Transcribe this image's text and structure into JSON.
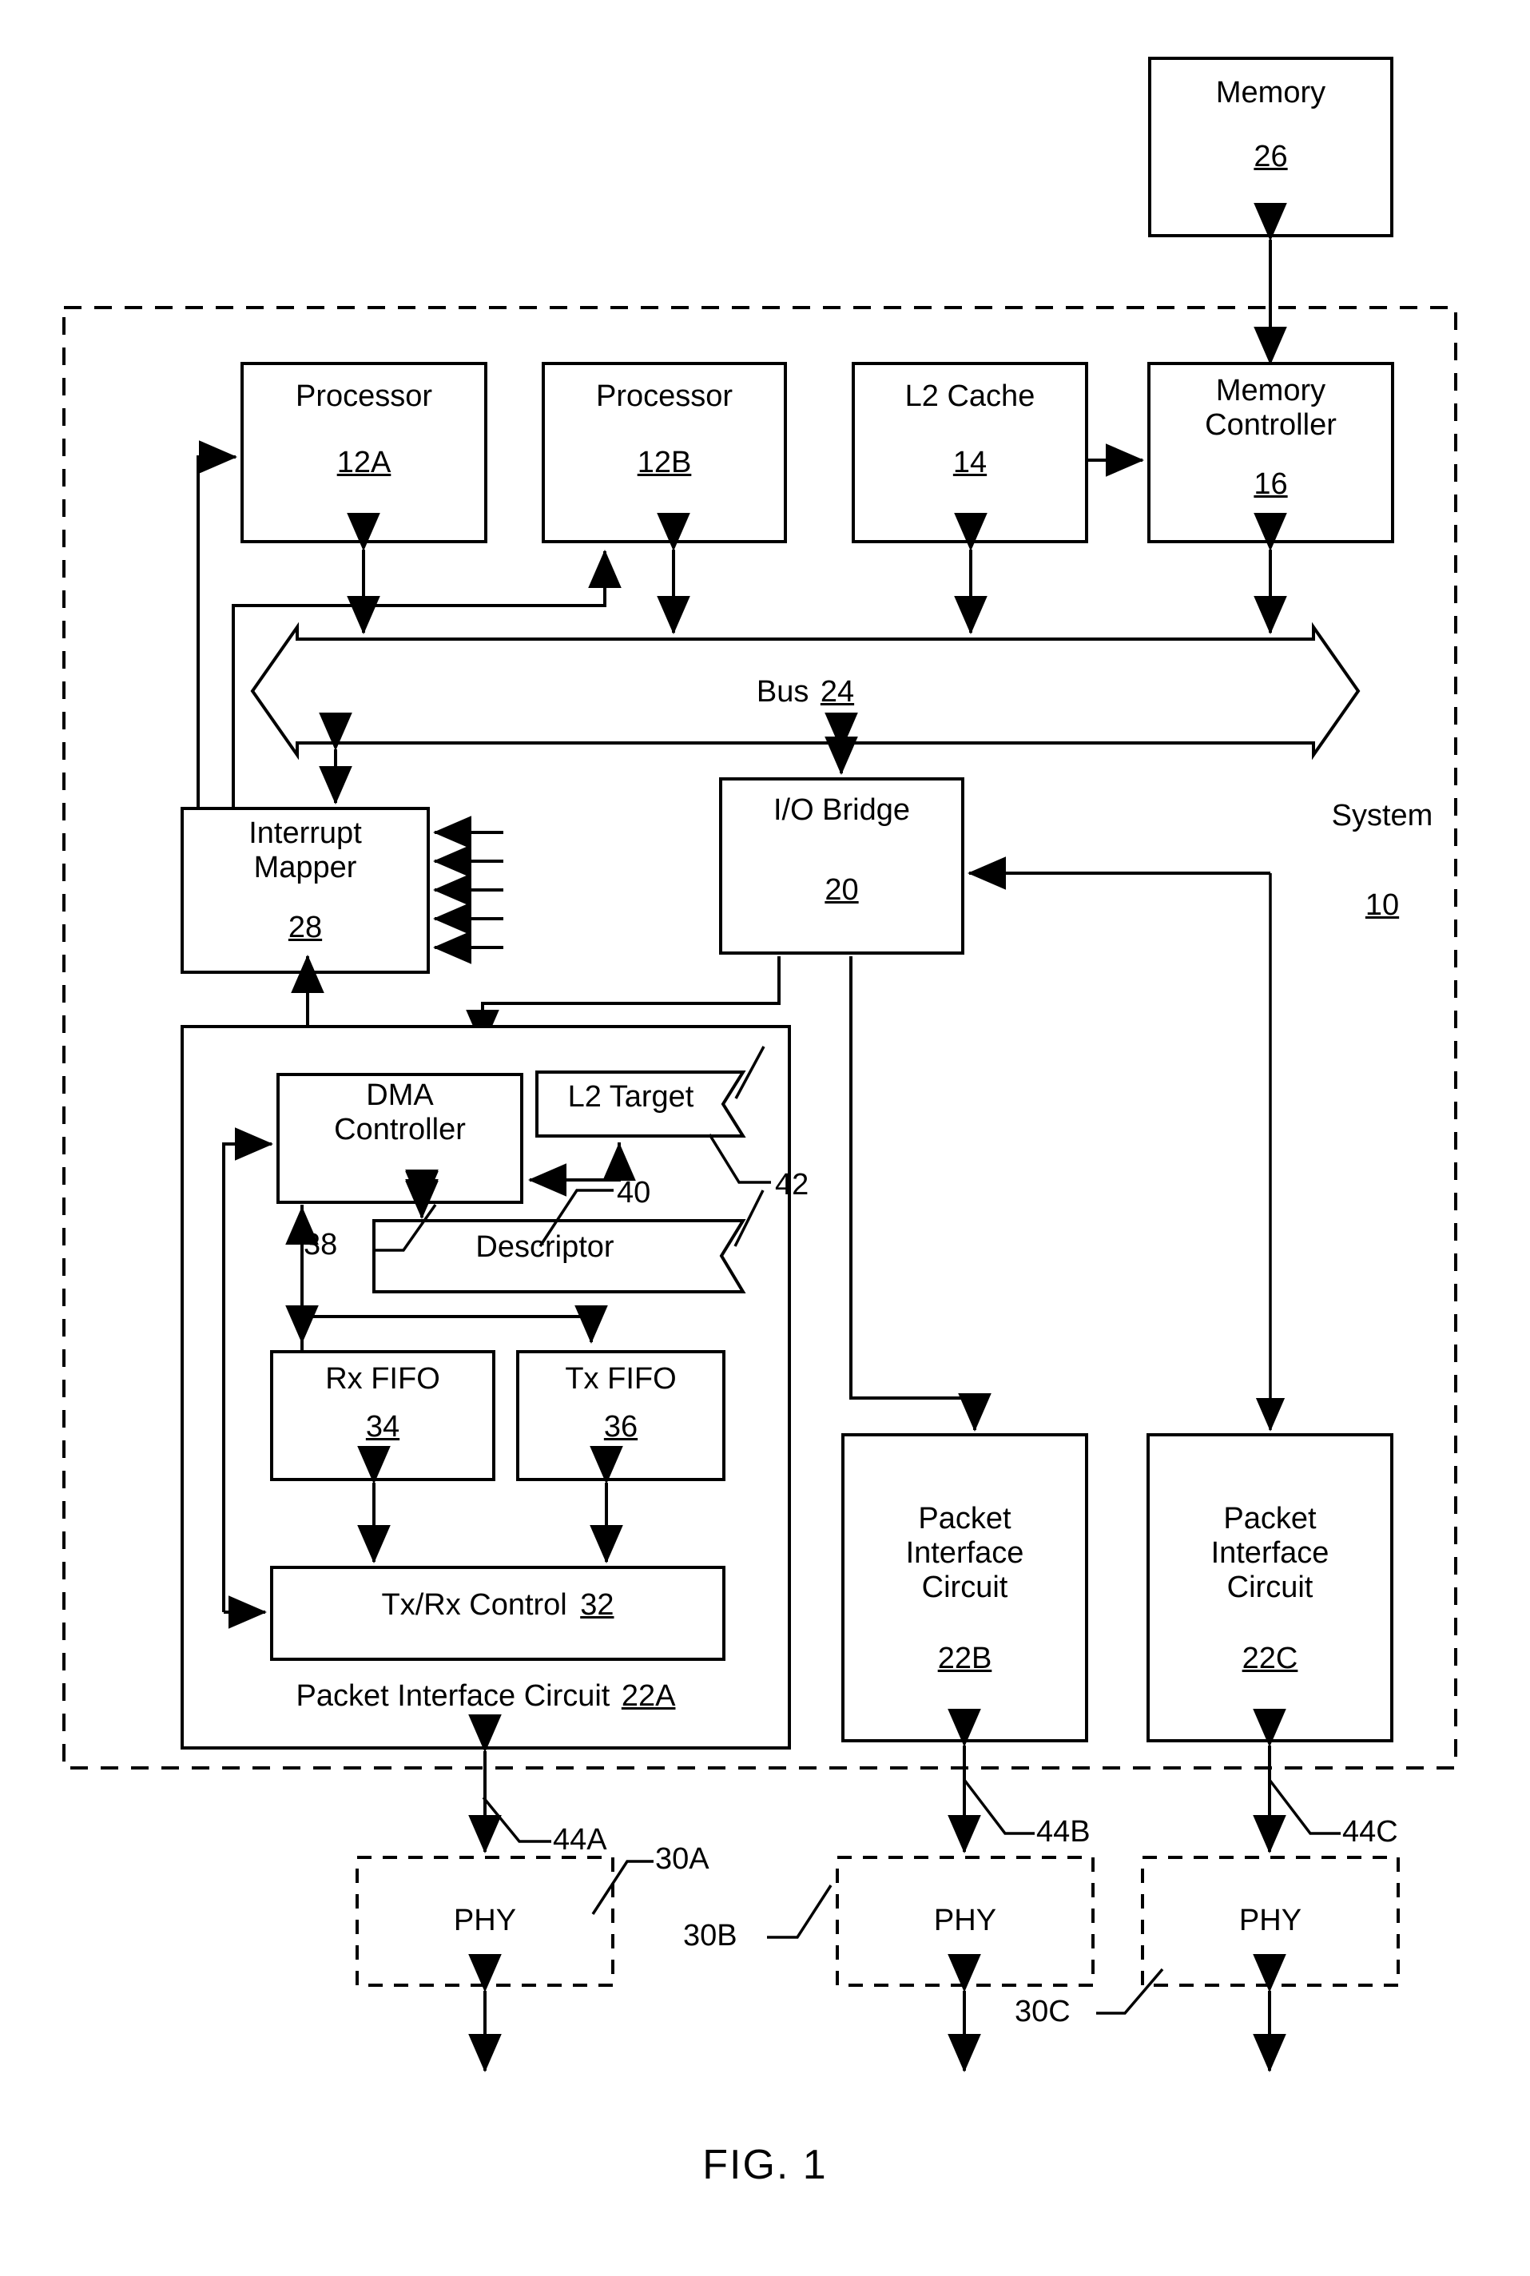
{
  "figure": {
    "caption": "FIG. 1",
    "system_label": "System",
    "system_ref": "10"
  },
  "blocks": {
    "memory": {
      "label": "Memory",
      "ref": "26"
    },
    "processor_a": {
      "label": "Processor",
      "ref": "12A"
    },
    "processor_b": {
      "label": "Processor",
      "ref": "12B"
    },
    "l2_cache": {
      "label": "L2 Cache",
      "ref": "14"
    },
    "memory_controller": {
      "label_line1": "Memory",
      "label_line2": "Controller",
      "ref": "16"
    },
    "bus": {
      "label": "Bus",
      "ref": "24"
    },
    "interrupt_mapper": {
      "label_line1": "Interrupt",
      "label_line2": "Mapper",
      "ref": "28"
    },
    "io_bridge": {
      "label": "I/O Bridge",
      "ref": "20"
    },
    "dma_controller": {
      "label_line1": "DMA",
      "label_line2": "Controller",
      "ref": "38"
    },
    "l2_target": {
      "label": "L2 Target",
      "ref": "42"
    },
    "descriptor": {
      "label": "Descriptor",
      "ref": "40"
    },
    "rx_fifo": {
      "label": "Rx FIFO",
      "ref": "34"
    },
    "tx_fifo": {
      "label": "Tx FIFO",
      "ref": "36"
    },
    "txrx_control": {
      "label": "Tx/Rx Control",
      "ref": "32"
    },
    "packet_interface_a": {
      "label": "Packet Interface Circuit",
      "ref": "22A"
    },
    "packet_interface_b": {
      "label_line1": "Packet",
      "label_line2": "Interface",
      "label_line3": "Circuit",
      "ref": "22B"
    },
    "packet_interface_c": {
      "label_line1": "Packet",
      "label_line2": "Interface",
      "label_line3": "Circuit",
      "ref": "22C"
    },
    "phy_a": {
      "label": "PHY",
      "ref": "30A"
    },
    "phy_b": {
      "label": "PHY",
      "ref": "30B"
    },
    "phy_c": {
      "label": "PHY",
      "ref": "30C"
    }
  },
  "connection_refs": {
    "link_a": "44A",
    "link_b": "44B",
    "link_c": "44C"
  },
  "colors": {
    "stroke": "#000000",
    "fill": "#ffffff"
  }
}
